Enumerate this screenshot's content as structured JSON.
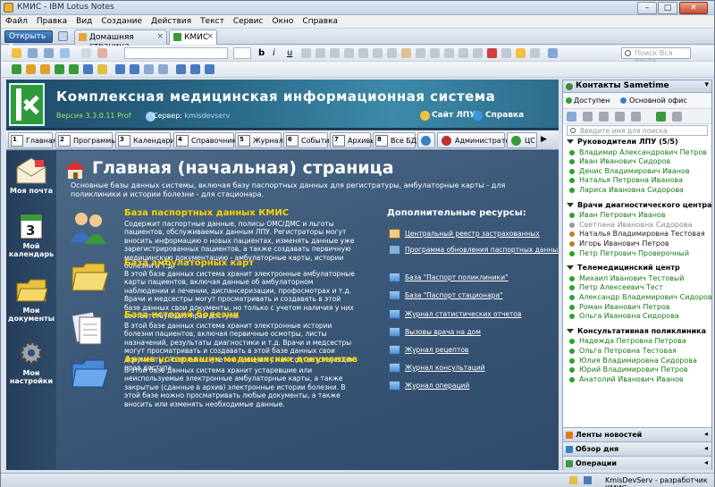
{
  "window": {
    "title": "КМИС - IBM Lotus Notes"
  },
  "menu": [
    "Файл",
    "Правка",
    "Вид",
    "Создание",
    "Действия",
    "Текст",
    "Сервис",
    "Окно",
    "Справка"
  ],
  "tabs": {
    "open_label": "Открыть",
    "home_tab": "Домашняя страница",
    "kmis_tab": "КМИС"
  },
  "toolbar": {
    "search_placeholder": "Поиск Вся почта"
  },
  "header": {
    "title": "Комплексная медицинская информационная система",
    "version": "Версия 3.3.0.11 Prof",
    "server_label": "Сервер:",
    "server_value": "kmisdevserv",
    "site_link": "Сайт ЛПУ",
    "help_link": "Справка"
  },
  "nav": [
    {
      "num": "1",
      "label": "Главная"
    },
    {
      "num": "2",
      "label": "Программы"
    },
    {
      "num": "3",
      "label": "Календари"
    },
    {
      "num": "4",
      "label": "Справочники"
    },
    {
      "num": "5",
      "label": "Журналы"
    },
    {
      "num": "6",
      "label": "События"
    },
    {
      "num": "7",
      "label": "Архивы"
    },
    {
      "num": "8",
      "label": "Все БД"
    },
    {
      "num": "",
      "label": ""
    },
    {
      "num": "",
      "label": "Администратор"
    },
    {
      "num": "",
      "label": "ЦС"
    }
  ],
  "left_pane": [
    "Моя почта",
    "Мой календарь",
    "Мои документы",
    "Мои настройки"
  ],
  "page": {
    "title": "Главная (начальная) страница",
    "intro": "Основные базы данных системы, включая базу паспортных данных для регистратуры, амбулаторные карты - для поликлиники и истории болезни - для стационара."
  },
  "sections": [
    {
      "title": "База паспортных данных КМИС",
      "text": "Содержит паспортные данные, полисы ОМС/ДМС и льготы пациентов, обслуживаемых данным ЛПУ. Регистраторы могут вносить информацию о новых пациентах, изменять данные уже зарегистрированных пациентов, а также создавать первичную медицинскую документацию - амбулаторные карты, истории болезни и т.д."
    },
    {
      "title": "База амбулаторных карт",
      "text": "В этой базе данных система хранит электронные амбулаторные карты пациентов, включая данные об амбулаторном наблюдении и лечении, диспансеризации, профосмотрах и т.д. Врачи и медсестры могут просматривать и создавать в этой базе данных свои документы, но только с учетом наличия у них соответствующих прав доступа."
    },
    {
      "title": "База историй болезни",
      "text": "В этой базе данных система хранит электронные истории болезни пациентов, включая первичные осмотры, листы назначений, результаты диагностики и т.д. Врачи и медсестры могут просматривать и создавать в этой базе данных свои документы, но только с учетом наличия у них соответствующих прав доступа."
    },
    {
      "title": "Архив устаревших медицинских документов",
      "text": "В этой базе данных система хранит устаревшие или неиспользуемые электронные амбулаторные карты, а также закрытые (сданные в архив) электронные истории болезни. В этой базе можно просматривать любые документы, а также вносить или изменять необходимые данные."
    }
  ],
  "resources": {
    "heading": "Дополнительные ресурсы:",
    "links": [
      "Центральный реестр застрахованных",
      "Программа обновления паспортных данных",
      "База \"Паспорт поликлиники\"",
      "База \"Паспорт стационара\"",
      "Журнал статистических отчетов",
      "Вызовы врача на дом",
      "Журнал рецептов",
      "Журнал консультаций",
      "Журнал операций"
    ]
  },
  "sidebar": {
    "title": "Контакты Sametime",
    "status": "Доступен",
    "location": "Основной офис",
    "search_placeholder": "Введите имя для поиска",
    "groups": [
      {
        "name": "Руководители ЛПУ (5/5)",
        "contacts": [
          {
            "n": "Владимир Александрович Петров",
            "s": "on"
          },
          {
            "n": "Иван Иванович Сидоров",
            "s": "on"
          },
          {
            "n": "Денис Владимирович Иванов",
            "s": "on"
          },
          {
            "n": "Наталья Петровна Иванова",
            "s": "on"
          },
          {
            "n": "Лариса Ивановна Сидорова",
            "s": "on"
          }
        ]
      },
      {
        "name": "Врачи диагностического центра",
        "contacts": [
          {
            "n": "Иван Петрович Иванов",
            "s": "on"
          },
          {
            "n": "Светлана Ивановна Сидорова",
            "s": "off"
          },
          {
            "n": "Наталья Владимировна Тестовая",
            "s": "blk"
          },
          {
            "n": "Игорь Иванович Петров",
            "s": "blk"
          },
          {
            "n": "Петр Петрович Проверочный",
            "s": "on"
          }
        ]
      },
      {
        "name": "Телемедицинский центр",
        "contacts": [
          {
            "n": "Михаил Иванович Тестовый",
            "s": "on"
          },
          {
            "n": "Петр Алексеевич Тест",
            "s": "on"
          },
          {
            "n": "Александр Владимирович Сидоров",
            "s": "on"
          },
          {
            "n": "Роман Иванович Петров",
            "s": "on"
          },
          {
            "n": "Ольга Ивановна Сидорова",
            "s": "on"
          }
        ]
      },
      {
        "name": "Консультативная поликлиника",
        "contacts": [
          {
            "n": "Надежда Петровна Петрова",
            "s": "on"
          },
          {
            "n": "Ольга Петровна Тестовая",
            "s": "on"
          },
          {
            "n": "Юлия Владимировна Сидорова",
            "s": "on"
          },
          {
            "n": "Юрий Владимирович Петров",
            "s": "on"
          },
          {
            "n": "Анатолий Иванович Иванов",
            "s": "on"
          }
        ]
      }
    ],
    "accordions": [
      "Ленты новостей",
      "Обзор дня",
      "Операции"
    ]
  },
  "statusbar": {
    "text": "KmisDevServ - разработчик КМИС"
  },
  "colors": {
    "accent_yellow": "#ffd200",
    "online_green": "#1a7a1a",
    "version_green": "#a5e05a"
  }
}
